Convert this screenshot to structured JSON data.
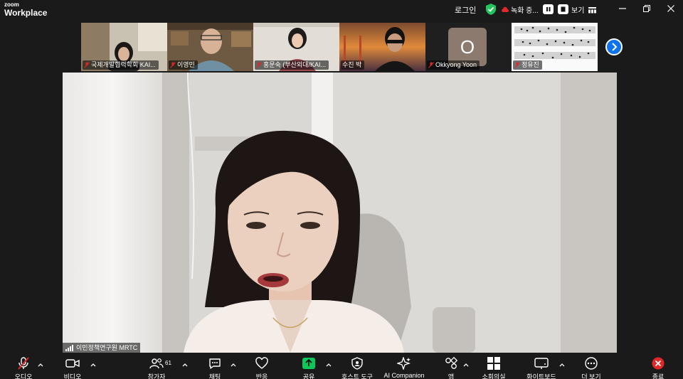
{
  "app": {
    "brand_small": "zoom",
    "brand_large": "Workplace"
  },
  "titlebar": {
    "login": "로그인",
    "recording": "녹화 중...",
    "view": "보기"
  },
  "thumbnails": [
    {
      "name": "국제개발협력학회 KAI...",
      "icon": "mic-muted-icon"
    },
    {
      "name": "이영민",
      "icon": "mic-muted-icon"
    },
    {
      "name": "홍문숙 (부산외대/KAI...",
      "icon": "mic-muted-icon"
    },
    {
      "name": "수진 박",
      "icon": "mic-muted-icon"
    },
    {
      "name": "Okkyong Yoon",
      "avatar_letter": "O",
      "icon": "mic-muted-icon"
    },
    {
      "name": "정유진",
      "icon": "mic-muted-icon"
    }
  ],
  "main": {
    "speaker_name": "이민정책연구원 MRTC"
  },
  "toolbar": {
    "audio": "오디오",
    "video": "비디오",
    "participants": "참가자",
    "participants_count": "61",
    "chat": "채팅",
    "reactions": "반응",
    "share": "공유",
    "host_tools": "호스트 도구",
    "ai_companion": "AI Companion",
    "apps": "앱",
    "meeting_summary": "소회의실",
    "whiteboard": "화이트보드",
    "more": "더 보기",
    "end": "종료"
  },
  "colors": {
    "accent": "#0e72ed",
    "share_green": "#0cc85a",
    "end_red": "#e02828",
    "security_green": "#22c55e"
  }
}
